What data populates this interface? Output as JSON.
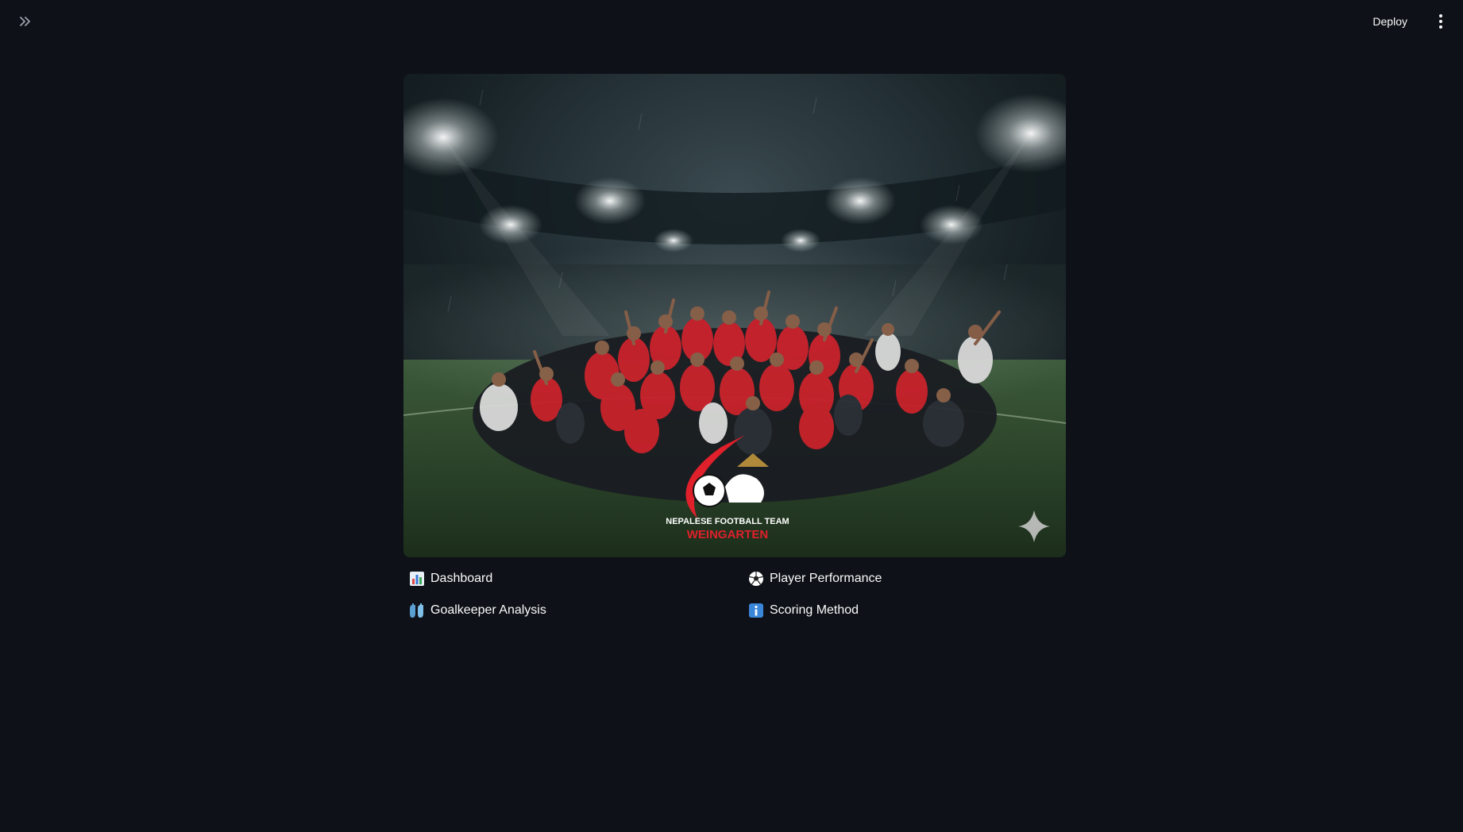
{
  "header": {
    "sidebar_toggle_icon": "double-chevron-right-icon",
    "deploy_label": "Deploy",
    "menu_icon": "vertical-dots-icon"
  },
  "hero": {
    "logo_text_line1": "NEPALESE FOOTBALL TEAM",
    "logo_text_line2": "WEINGARTEN"
  },
  "nav": {
    "items": [
      {
        "label": "Dashboard",
        "icon": "bar-chart-icon"
      },
      {
        "label": "Player Performance",
        "icon": "soccer-ball-icon"
      },
      {
        "label": "Goalkeeper Analysis",
        "icon": "gloves-icon"
      },
      {
        "label": "Scoring Method",
        "icon": "info-icon"
      }
    ]
  },
  "colors": {
    "background": "#0e1117",
    "text": "#fafafa",
    "jersey_red": "#c8202a",
    "pitch_green": "#2f4a2a",
    "logo_red": "#e0202a"
  }
}
